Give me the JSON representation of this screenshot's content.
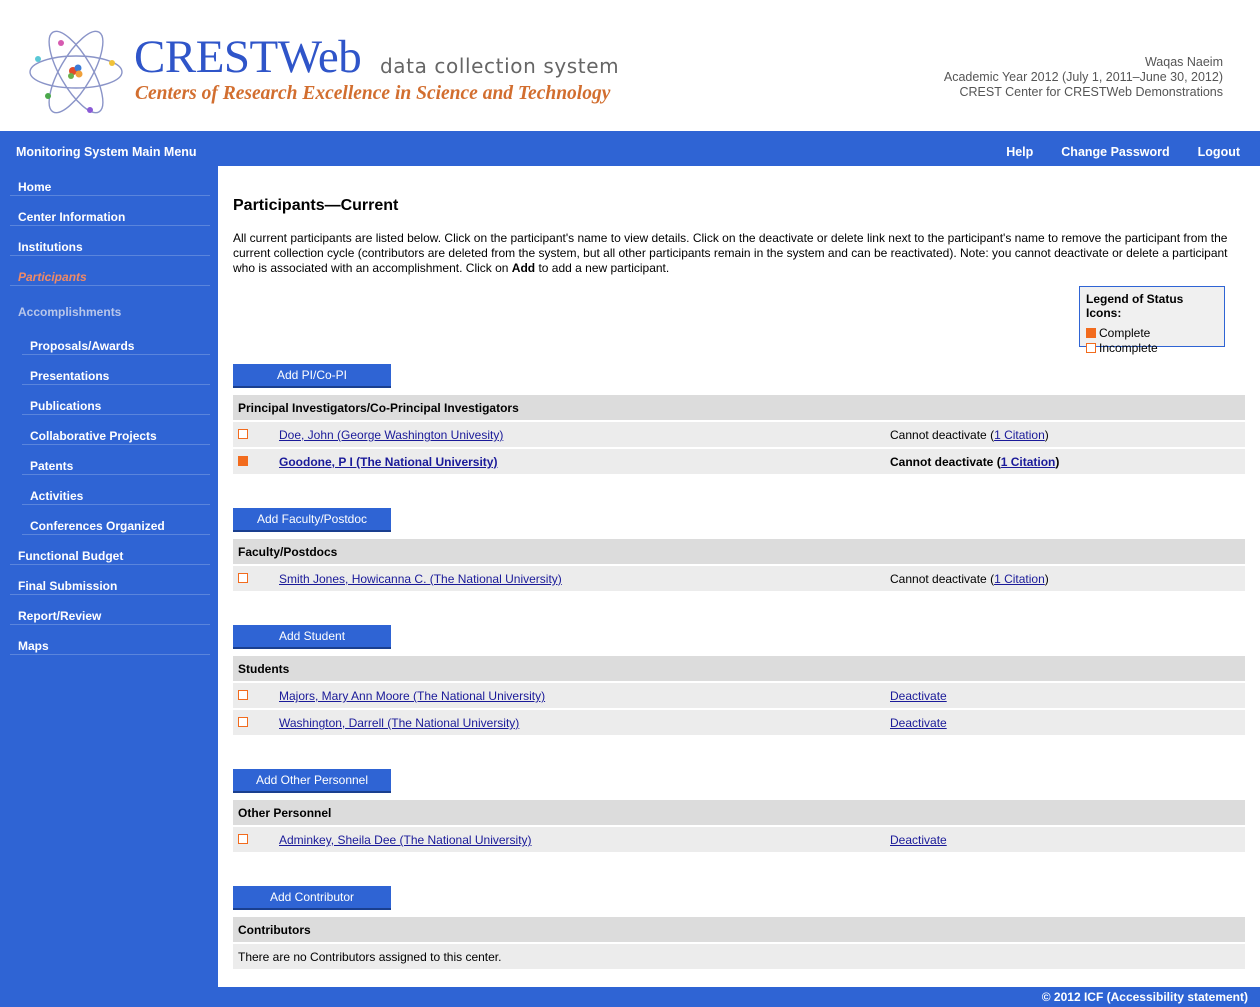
{
  "brand": {
    "title": "CRESTWeb",
    "subtitle": "data collection system",
    "tagline": "Centers of Research Excellence in Science and Technology",
    "title_color": "#2f55c9",
    "tagline_color": "#d26e2f"
  },
  "user": {
    "name": "Waqas Naeim",
    "academic_year": "Academic Year 2012 (July 1, 2011–June 30, 2012)",
    "center": "CREST Center for CRESTWeb Demonstrations"
  },
  "topnav": {
    "menu_title": "Monitoring System Main Menu",
    "help": "Help",
    "change_password": "Change Password",
    "logout": "Logout"
  },
  "sidebar": {
    "home": "Home",
    "center_information": "Center Information",
    "institutions": "Institutions",
    "participants": "Participants",
    "accomplishments": "Accomplishments",
    "proposals_awards": "Proposals/Awards",
    "presentations": "Presentations",
    "publications": "Publications",
    "collaborative_projects": "Collaborative Projects",
    "patents": "Patents",
    "activities": "Activities",
    "conferences_organized": "Conferences Organized",
    "functional_budget": "Functional Budget",
    "final_submission": "Final Submission",
    "report_review": "Report/Review",
    "maps": "Maps"
  },
  "page": {
    "title": "Participants—Current",
    "intro_1": "All current participants are listed below. Click on the participant's name to view details. Click on the deactivate or delete link next to the participant's name to remove the participant from the current collection cycle (contributors are deleted from the system, but all other participants remain in the system and can be reactivated). Note: you cannot deactivate or delete a participant who is associated with an accomplishment. Click on ",
    "intro_bold": "Add",
    "intro_2": " to add a new participant."
  },
  "legend": {
    "title": "Legend of Status Icons:",
    "complete": "Complete",
    "incomplete": "Incomplete",
    "accent_color": "#f26b1d"
  },
  "common": {
    "cannot_deactivate": "Cannot deactivate (",
    "close_paren": ")",
    "deactivate": "Deactivate"
  },
  "sections": {
    "pi": {
      "button": "Add PI/Co-PI",
      "header": "Principal Investigators/Co-Principal Investigators",
      "rows": [
        {
          "name": "Doe, John (George Washington Univesity)",
          "citation": "1 Citation"
        },
        {
          "name": "Goodone, P I (The National University)",
          "citation": "1 Citation"
        }
      ]
    },
    "faculty": {
      "button": "Add Faculty/Postdoc",
      "header": "Faculty/Postdocs",
      "rows": [
        {
          "name": "Smith Jones, Howicanna C. (The National University)",
          "citation": "1 Citation"
        }
      ]
    },
    "students": {
      "button": "Add Student",
      "header": "Students",
      "rows": [
        {
          "name": "Majors, Mary Ann Moore (The National University)"
        },
        {
          "name": "Washington, Darrell (The National University)"
        }
      ]
    },
    "other": {
      "button": "Add Other Personnel",
      "header": "Other Personnel",
      "rows": [
        {
          "name": "Adminkey, Sheila Dee (The National University)"
        }
      ]
    },
    "contributors": {
      "button": "Add Contributor",
      "header": "Contributors",
      "empty": "There are no Contributors assigned to this center."
    }
  },
  "footer": {
    "copyright": "© 2012 ICF (Accessibility statement)"
  }
}
